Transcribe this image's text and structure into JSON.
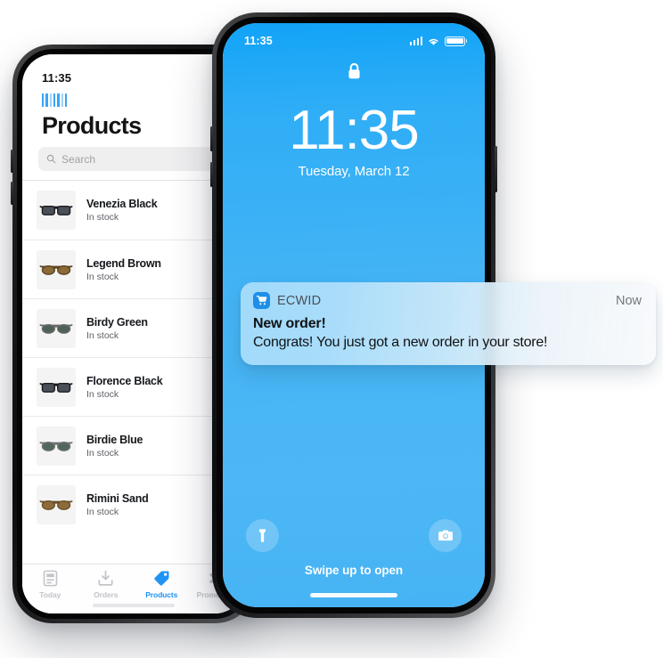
{
  "left_phone": {
    "status_bar": {
      "time": "11:35"
    },
    "brand_icon": "barcode-icon",
    "page_title": "Products",
    "search": {
      "placeholder": "Search",
      "value": "",
      "icon": "search-icon"
    },
    "products": [
      {
        "name": "Venezia Black",
        "stock": "In stock",
        "lens_color": "#4b4f57",
        "frame_color": "#1c1c20",
        "shape": "rect"
      },
      {
        "name": "Legend Brown",
        "stock": "In stock",
        "lens_color": "#8a6a36",
        "frame_color": "#5c4420",
        "shape": "round"
      },
      {
        "name": "Birdy Green",
        "stock": "In stock",
        "lens_color": "#4e6155",
        "frame_color": "#69696b",
        "shape": "round"
      },
      {
        "name": "Florence Black",
        "stock": "In stock",
        "lens_color": "#4b4f57",
        "frame_color": "#1c1c20",
        "shape": "rect"
      },
      {
        "name": "Birdie Blue",
        "stock": "In stock",
        "lens_color": "#52675c",
        "frame_color": "#6e7073",
        "shape": "round"
      },
      {
        "name": "Rimini Sand",
        "stock": "In stock",
        "lens_color": "#8d6c3c",
        "frame_color": "#6b5026",
        "shape": "round"
      }
    ],
    "tabs": [
      {
        "label": "Today",
        "icon": "today-document-icon",
        "active": false
      },
      {
        "label": "Orders",
        "icon": "orders-inbox-icon",
        "active": false
      },
      {
        "label": "Products",
        "icon": "products-tag-icon",
        "active": true
      },
      {
        "label": "Promotions",
        "icon": "promotions-ticket-icon",
        "active": false
      }
    ],
    "colors": {
      "accent": "#1f93f2",
      "inactive_tab": "#c2c3c8",
      "search_bg": "#efeff0"
    }
  },
  "right_phone": {
    "status_bar": {
      "time": "11:35",
      "icons": [
        "signal-icon",
        "wifi-icon",
        "battery-icon"
      ]
    },
    "lock_icon": "lock-closed-icon",
    "clock": {
      "time": "11:35",
      "date": "Tuesday, March 12"
    },
    "notification": {
      "app_icon": "shopping-cart-icon",
      "app_name": "ECWID",
      "time": "Now",
      "title": "New order!",
      "body": "Congrats! You just got a new order in your store!"
    },
    "actions": [
      {
        "name": "flashlight-button",
        "icon": "flashlight-icon"
      },
      {
        "name": "camera-button",
        "icon": "camera-icon"
      }
    ],
    "swipe_hint": "Swipe up to open",
    "colors": {
      "wallpaper_top": "#11a3f7",
      "wallpaper_bottom": "#46b3f4"
    }
  }
}
